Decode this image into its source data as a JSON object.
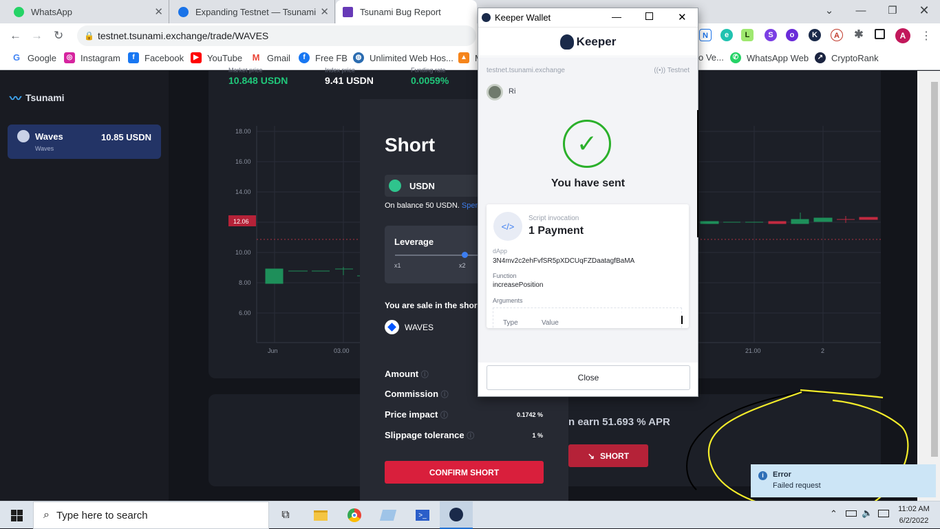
{
  "browser": {
    "tabs": [
      {
        "title": "WhatsApp",
        "icon": "whatsapp-icon",
        "color": "#25d366"
      },
      {
        "title": "Expanding Testnet — Tsunami Ex",
        "icon": "doc-icon",
        "color": "#1a73e8"
      },
      {
        "title": "Tsunami Bug Report",
        "icon": "form-icon",
        "color": "#673ab7"
      }
    ],
    "url": "testnet.tsunami.exchange/trade/WAVES",
    "profile_initial": "A",
    "bookmarks": [
      {
        "label": "Google",
        "color": "#4285f4"
      },
      {
        "label": "Instagram",
        "color": "#d6249f"
      },
      {
        "label": "Facebook",
        "color": "#1877f2"
      },
      {
        "label": "YouTube",
        "color": "#ff0000"
      },
      {
        "label": "Gmail",
        "color": "#ea4335"
      },
      {
        "label": "Free FB",
        "color": "#1877f2"
      },
      {
        "label": "Unlimited Web Hos...",
        "color": "#2b6cb0"
      },
      {
        "label": "M",
        "color": "#f6851b"
      },
      {
        "label": "o Ve...",
        "color": "#888888"
      },
      {
        "label": "WhatsApp Web",
        "color": "#25d366"
      },
      {
        "label": "CryptoRank",
        "color": "#1b2440"
      }
    ]
  },
  "app": {
    "brand": "Tsunami",
    "market": {
      "name": "Waves",
      "sub": "Waves",
      "price": "10.85 USDN"
    },
    "stats": [
      {
        "label": "Market price",
        "value": "10.848 USDN",
        "color": "#20c77a"
      },
      {
        "label": "Index price",
        "value": "9.41 USDN",
        "color": "#ffffff"
      },
      {
        "label": "Funding rate",
        "value": "0.0059%",
        "color": "#20c77a"
      }
    ],
    "chart": {
      "y_ticks": [
        "18.00",
        "16.00",
        "14.00",
        "10.00",
        "8.00",
        "6.00"
      ],
      "current_price": "12.06",
      "x_ticks": [
        "Jun",
        "03.00",
        "21.00",
        "2"
      ]
    },
    "short_panel": {
      "title": "Short",
      "asset": "USDN",
      "balance": "On balance 50 USDN.",
      "spend_link": "Spend",
      "leverage_label": "Leverage",
      "leverage_ticks": [
        "x1",
        "x2"
      ],
      "sale_text": "You are sale in the shor",
      "sale_asset": "WAVES",
      "rows": [
        {
          "label": "Amount",
          "value": ""
        },
        {
          "label": "Commission",
          "value": ""
        },
        {
          "label": "Price impact",
          "value": "0.1742 %"
        },
        {
          "label": "Slippage tolerance",
          "value": "1 %"
        }
      ],
      "confirm_label": "CONFIRM SHORT"
    },
    "earn_text": "n earn 51.693 % APR",
    "short_button": "SHORT"
  },
  "keeper": {
    "window_title": "Keeper Wallet",
    "logo_text": "Keeper",
    "origin": "testnet.tsunami.exchange",
    "network": "Testnet",
    "account": "Ri",
    "status": "You have sent",
    "tx_type": "Script invocation",
    "tx_title": "1 Payment",
    "dapp_label": "dApp",
    "dapp_value": "3N4mv2c2ehFvfSR5pXDCUqFZDaatagfBaMA",
    "function_label": "Function",
    "function_value": "increasePosition",
    "arguments_label": "Arguments",
    "arg_col_type": "Type",
    "arg_col_value": "Value",
    "close_label": "Close",
    "accent": "#2bb02b"
  },
  "notification": {
    "title": "Error",
    "message": "Failed request"
  },
  "taskbar": {
    "search_placeholder": "Type here to search",
    "time": "11:02 AM",
    "date": "6/2/2022"
  }
}
